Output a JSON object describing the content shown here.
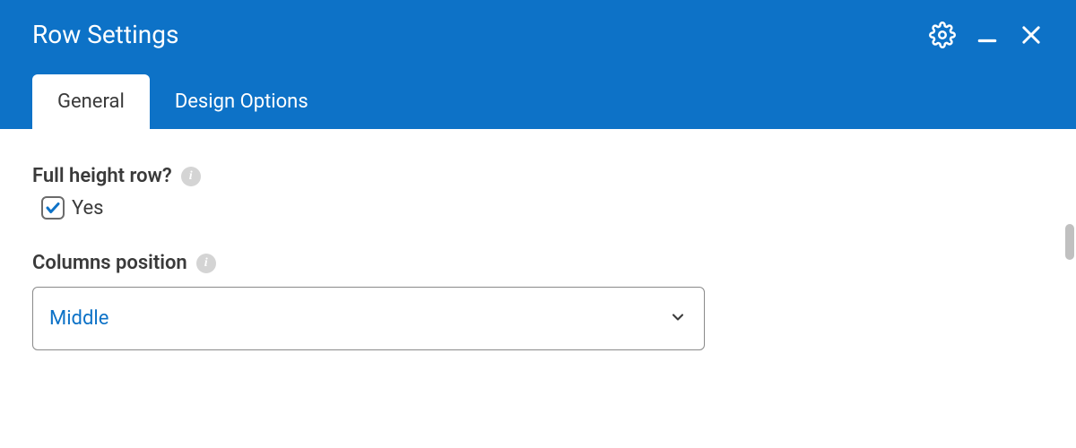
{
  "header": {
    "title": "Row Settings",
    "tabs": [
      {
        "label": "General",
        "active": true
      },
      {
        "label": "Design Options",
        "active": false
      }
    ]
  },
  "content": {
    "full_height": {
      "label": "Full height row?",
      "checkbox_label": "Yes",
      "checked": true
    },
    "columns_position": {
      "label": "Columns position",
      "value": "Middle"
    }
  }
}
